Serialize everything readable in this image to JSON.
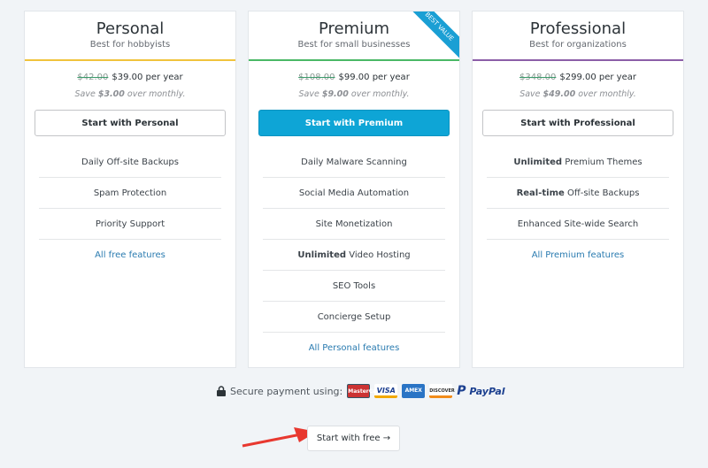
{
  "plans": [
    {
      "name": "Personal",
      "tagline": "Best for hobbyists",
      "old_price": "$42.00",
      "price": "$39.00 per year",
      "save_pre": "Save ",
      "save_amt": "$3.00",
      "save_post": " over monthly.",
      "button": "Start with Personal",
      "accent": "#f0c33c",
      "features": [
        {
          "pre": "",
          "bold": "",
          "text": "Daily Off-site Backups"
        },
        {
          "pre": "",
          "bold": "",
          "text": "Spam Protection"
        },
        {
          "pre": "",
          "bold": "",
          "text": "Priority Support"
        }
      ],
      "link": "All free features"
    },
    {
      "name": "Premium",
      "tagline": "Best for small businesses",
      "old_price": "$108.00",
      "price": "$99.00 per year",
      "save_pre": "Save ",
      "save_amt": "$9.00",
      "save_post": " over monthly.",
      "button": "Start with Premium",
      "accent": "#4ab866",
      "ribbon": "BEST VALUE",
      "features": [
        {
          "bold": "",
          "text": "Daily Malware Scanning"
        },
        {
          "bold": "",
          "text": "Social Media Automation"
        },
        {
          "bold": "",
          "text": "Site Monetization"
        },
        {
          "bold": "Unlimited",
          "text": " Video Hosting"
        },
        {
          "bold": "",
          "text": "SEO Tools"
        },
        {
          "bold": "",
          "text": "Concierge Setup"
        }
      ],
      "link": "All Personal features"
    },
    {
      "name": "Professional",
      "tagline": "Best for organizations",
      "old_price": "$348.00",
      "price": "$299.00 per year",
      "save_pre": "Save ",
      "save_amt": "$49.00",
      "save_post": " over monthly.",
      "button": "Start with Professional",
      "accent": "#8c5ea8",
      "features": [
        {
          "bold": "Unlimited",
          "text": " Premium Themes"
        },
        {
          "bold": "Real-time",
          "text": " Off-site Backups"
        },
        {
          "bold": "",
          "text": "Enhanced Site-wide Search"
        }
      ],
      "link": "All Premium features"
    }
  ],
  "secure": {
    "label": "Secure payment using:",
    "cards": [
      "MasterCard",
      "VISA",
      "AMEX",
      "DISCOVER"
    ],
    "paypal": "PayPal"
  },
  "free_button": "Start with free",
  "free_arrow": "→"
}
